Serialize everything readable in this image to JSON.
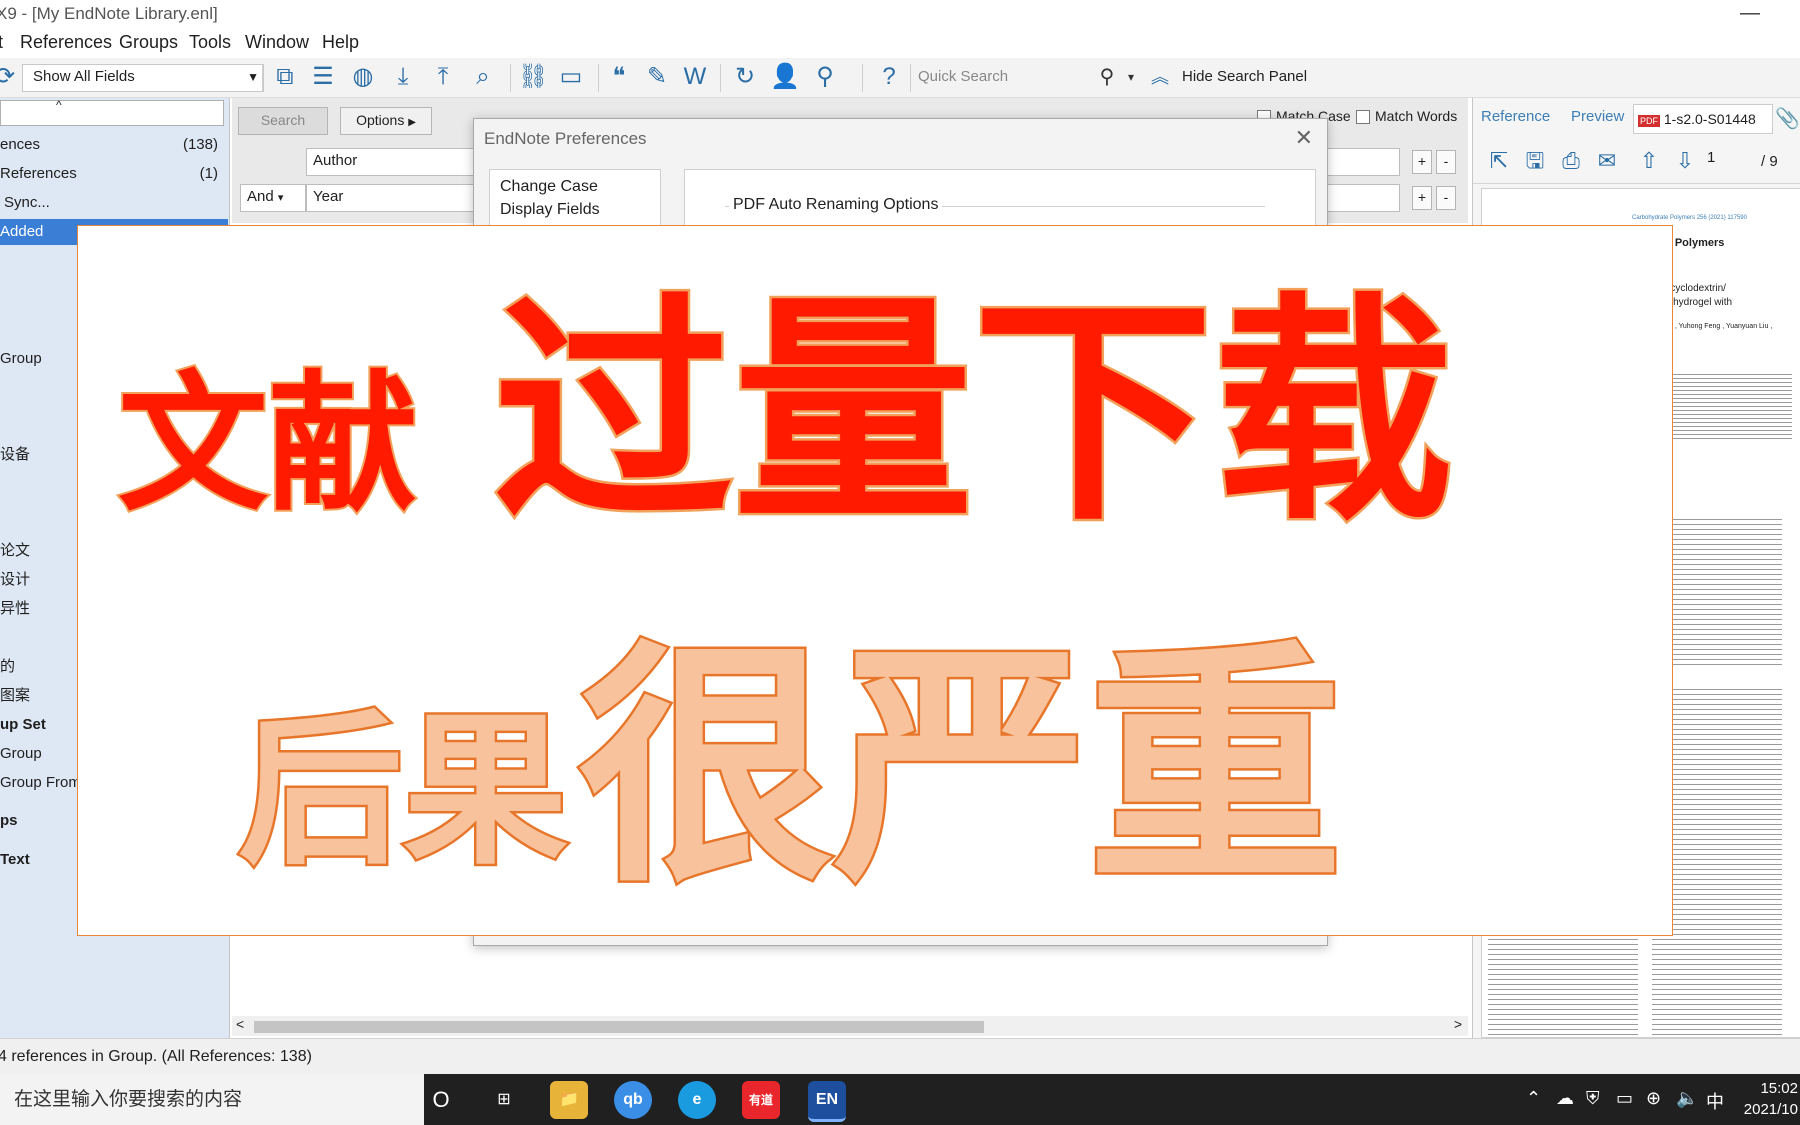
{
  "window": {
    "title": "X9 - [My EndNote Library.enl]",
    "minimize_glyph": "—",
    "close_glyph": "✕"
  },
  "menu": {
    "items": [
      {
        "label": "t"
      },
      {
        "label": "References"
      },
      {
        "label": "Groups"
      },
      {
        "label": "Tools"
      },
      {
        "label": "Window"
      },
      {
        "label": "Help"
      }
    ]
  },
  "toolbar": {
    "field_select": "Show All Fields",
    "quick_search_placeholder": "Quick Search",
    "hide_search_panel": "Hide Search Panel"
  },
  "sidebar": {
    "items": [
      {
        "label": "ences",
        "count": "(138)"
      },
      {
        "label": "References",
        "count": "(1)"
      },
      {
        "label": "Sync...",
        "count": ""
      },
      {
        "label": "Added",
        "count": ""
      },
      {
        "label": "Group",
        "count": ""
      },
      {
        "label": "设备",
        "count": ""
      },
      {
        "label": "论文",
        "count": ""
      },
      {
        "label": "设计",
        "count": ""
      },
      {
        "label": "异性",
        "count": ""
      },
      {
        "label": "的",
        "count": ""
      },
      {
        "label": "图案",
        "count": ""
      },
      {
        "label": "up Set",
        "count": ""
      },
      {
        "label": "Group",
        "count": ""
      },
      {
        "label": "Group From",
        "count": ""
      },
      {
        "label": "ps",
        "count": ""
      },
      {
        "label": "Text",
        "count": ""
      }
    ]
  },
  "search_panel": {
    "search_button": "Search",
    "options_button": "Options",
    "field1": "Author",
    "connector": "And",
    "field2": "Year",
    "match_case": "Match Case",
    "match_words": "Match Words",
    "plus": "+",
    "minus": "-"
  },
  "dialog": {
    "title": "EndNote Preferences",
    "tree_items": [
      "Change Case",
      "Display Fields"
    ],
    "section_title": "PDF Auto Renaming Options"
  },
  "right_panel": {
    "tabs": [
      "Reference",
      "Preview"
    ],
    "pdf_tab": "1-s2.0-S01448",
    "page_current": "1",
    "page_total": "/ 9",
    "pdf_header": "Carbohydrate Polymers 256 (2021) 117590",
    "pdf_journal": "te Polymers",
    "pdf_title_1": "d cyclodextrin/",
    "pdf_title_2": "rk hydrogel with",
    "pdf_authors": "Qin , Yuhong Feng , Yuanyuan Liu ,"
  },
  "status": {
    "text": "4 references in Group. (All References: 138)"
  },
  "taskbar": {
    "search_placeholder": "在这里输入你要搜索的内容",
    "apps": [
      "O",
      "⊞",
      "📁",
      "qb",
      "e",
      "有道",
      "EN"
    ],
    "time": "15:02",
    "date": "2021/10"
  },
  "banner": {
    "line1_small": "文献",
    "line1_big": "过量下载",
    "line2_small": "后果",
    "line2_big": "很严重",
    "color_line1": "#ff1a00",
    "color_line2": "#f7c29c",
    "outline_line1": "#f2a15a",
    "outline_line2": "#e8762a"
  }
}
